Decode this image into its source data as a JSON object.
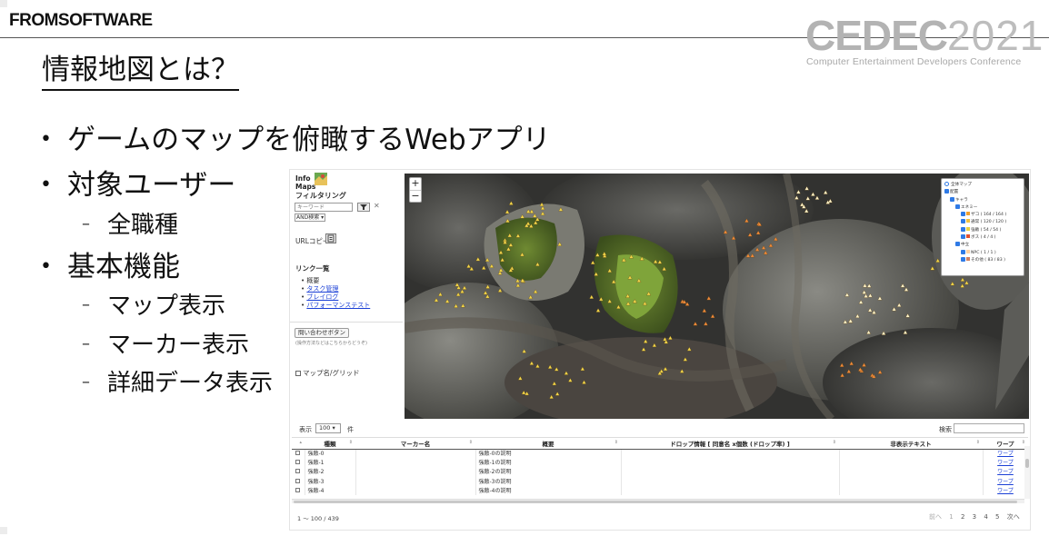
{
  "slide": {
    "brand": "FROMSOFTWARE",
    "event_logo": "CEDEC",
    "event_year": "2021",
    "event_subtitle": "Computer Entertainment Developers Conference",
    "title": "情報地図とは？",
    "bullets": [
      {
        "text": "ゲームのマップを俯瞰するWebアプリ",
        "level": 1
      },
      {
        "text": "対象ユーザー",
        "level": 1
      },
      {
        "text": "全職種",
        "level": 2
      },
      {
        "text": "基本機能",
        "level": 1
      },
      {
        "text": "マップ表示",
        "level": 2
      },
      {
        "text": "マーカー表示",
        "level": 2
      },
      {
        "text": "詳細データ表示",
        "level": 2
      }
    ]
  },
  "app": {
    "logo_line1": "Info",
    "logo_line2": "Maps",
    "filter_heading": "フィルタリング",
    "filter_placeholder": "キーワード",
    "filter_mode": "AND検索 ▾",
    "filter_clear": "✕",
    "url_copy_label": "URLコピー",
    "links_heading": "リンク一覧",
    "links": [
      {
        "label": "概要",
        "is_link": false
      },
      {
        "label": "タスク管理",
        "is_link": true
      },
      {
        "label": "ブレイログ",
        "is_link": true
      },
      {
        "label": "パフォーマンステスト",
        "is_link": true
      }
    ],
    "inquiry_button": "問い合わせボタン",
    "inquiry_note": "(操作方法などはこちらからどうぞ)",
    "grid_toggle": "マップ名/グリッド",
    "zoom_in": "+",
    "zoom_out": "−",
    "layers": [
      {
        "label": "全体マップ",
        "control": "radio",
        "indent": 0
      },
      {
        "label": "配置",
        "control": "check",
        "indent": 0
      },
      {
        "label": "キャラ",
        "control": "check",
        "indent": 1
      },
      {
        "label": "エネミー",
        "control": "check",
        "indent": 2
      },
      {
        "label": "ザコ ( 164 / 164 )",
        "control": "check",
        "indent": 3,
        "swatch": "#f0a030"
      },
      {
        "label": "通常 ( 120 / 120 )",
        "control": "check",
        "indent": 3,
        "swatch": "#f0c040"
      },
      {
        "label": "強敵 ( 54 / 54 )",
        "control": "check",
        "indent": 3,
        "swatch": "#e8d040"
      },
      {
        "label": "ボス ( 4 / 4 )",
        "control": "check",
        "indent": 3,
        "swatch": "#e05030"
      },
      {
        "label": "中立",
        "control": "check",
        "indent": 2
      },
      {
        "label": "NPC ( 1 / 1 )",
        "control": "check",
        "indent": 3,
        "swatch": "#ffd0a0"
      },
      {
        "label": "その他 ( 83 / 83 )",
        "control": "check",
        "indent": 3,
        "swatch": "#d08060"
      }
    ],
    "table_controls": {
      "show_label": "表示",
      "page_size": "100 ▾",
      "show_unit": "件",
      "search_label": "検索"
    },
    "table": {
      "columns": [
        "",
        "種類",
        "マーカー名",
        "概要",
        "ドロップ情報 [ 同意名 x個数 (ドロップ率) ]",
        "非表示テキスト",
        "ワープ"
      ],
      "rows": [
        [
          "",
          "強敵-0",
          "",
          "強敵-0の説明",
          "",
          "",
          "ワープ"
        ],
        [
          "",
          "強敵-1",
          "",
          "強敵-1の説明",
          "",
          "",
          "ワープ"
        ],
        [
          "",
          "強敵-2",
          "",
          "強敵-2の説明",
          "",
          "",
          "ワープ"
        ],
        [
          "",
          "強敵-3",
          "",
          "強敵-3の説明",
          "",
          "",
          "ワープ"
        ],
        [
          "",
          "強敵-4",
          "",
          "強敵-4の説明",
          "",
          "",
          "ワープ"
        ]
      ]
    },
    "paging_info": "1 ～ 100 / 439",
    "pager": {
      "prev": "前へ",
      "pages": [
        "1",
        "2",
        "3",
        "4",
        "5"
      ],
      "next": "次へ"
    }
  },
  "colors": {
    "link_blue": "#1a3fd6",
    "layer_check_blue": "#2f7ae5",
    "marker_yellow": "#f2d64a",
    "marker_orange": "#f08a3a",
    "marker_white": "#fff3c8"
  }
}
